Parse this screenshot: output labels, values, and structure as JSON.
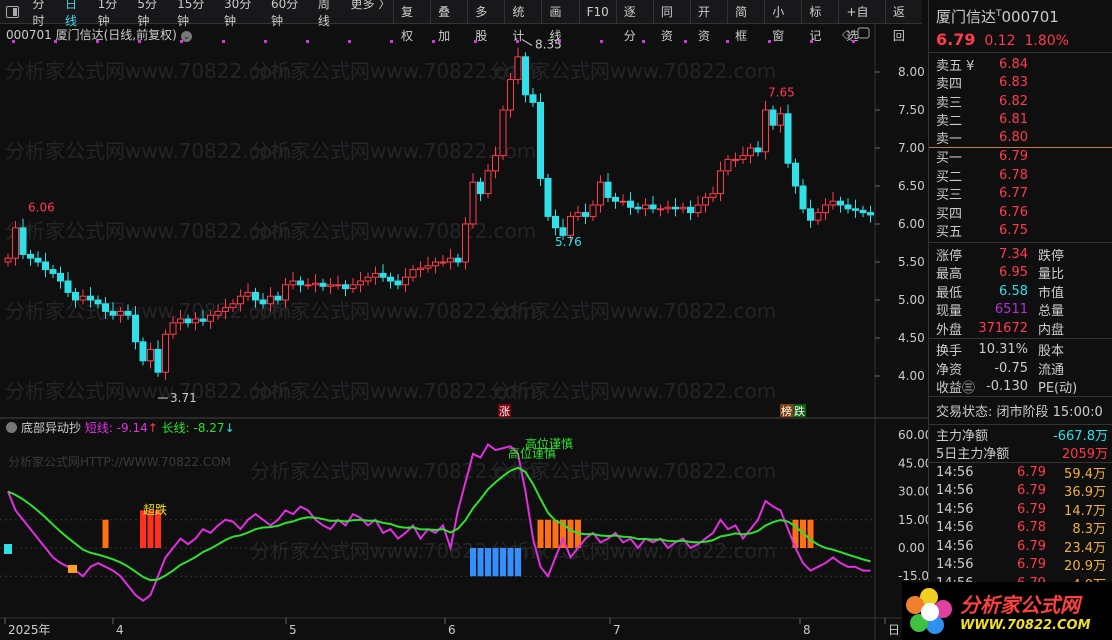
{
  "toolbar": {
    "periods": [
      "分时",
      "日线",
      "1分钟",
      "5分钟",
      "15分钟",
      "30分钟",
      "60分钟",
      "周线",
      "更多 〉"
    ],
    "active": 1,
    "buttons": [
      "复权",
      "叠加",
      "多股",
      "统计",
      "画线",
      "F10",
      "逐分",
      "同资",
      "开资",
      "简框",
      "小窗",
      "标记",
      "+自选",
      "返回"
    ]
  },
  "chart": {
    "title": "000701 厦门信达(日线,前复权)",
    "y_ticks": [
      "8.00",
      "7.50",
      "7.00",
      "6.50",
      "6.00",
      "5.50",
      "5.00",
      "4.50",
      "4.00"
    ],
    "labels": {
      "high1": "6.06",
      "peak": "8.35",
      "low1": "3.71",
      "low2": "5.76",
      "high2": "7.65"
    },
    "flags": {
      "up": "涨",
      "rank": "榜",
      "down": "跌"
    }
  },
  "chart_data": {
    "type": "candlestick",
    "ylim": [
      3.6,
      8.5
    ],
    "closes": [
      5.55,
      5.95,
      5.6,
      5.55,
      5.5,
      5.4,
      5.35,
      5.25,
      5.1,
      5.0,
      5.05,
      5.0,
      4.95,
      4.85,
      4.8,
      4.85,
      4.8,
      4.45,
      4.2,
      4.35,
      4.05,
      4.55,
      4.7,
      4.75,
      4.7,
      4.75,
      4.72,
      4.8,
      4.85,
      4.9,
      4.95,
      5.05,
      5.1,
      5.0,
      4.95,
      5.05,
      5.0,
      5.2,
      5.25,
      5.2,
      5.2,
      5.22,
      5.18,
      5.2,
      5.2,
      5.15,
      5.2,
      5.25,
      5.3,
      5.35,
      5.3,
      5.25,
      5.2,
      5.3,
      5.4,
      5.42,
      5.45,
      5.5,
      5.5,
      5.55,
      5.5,
      6.0,
      6.55,
      6.4,
      6.7,
      6.9,
      7.5,
      7.9,
      8.2,
      7.7,
      7.6,
      6.6,
      6.1,
      5.95,
      5.85,
      6.1,
      6.15,
      6.1,
      6.25,
      6.55,
      6.35,
      6.3,
      6.3,
      6.22,
      6.2,
      6.25,
      6.2,
      6.2,
      6.22,
      6.2,
      6.22,
      6.15,
      6.25,
      6.35,
      6.4,
      6.7,
      6.85,
      6.85,
      6.9,
      7.0,
      6.95,
      7.5,
      7.3,
      7.45,
      6.8,
      6.5,
      6.2,
      6.05,
      6.15,
      6.25,
      6.3,
      6.25,
      6.2,
      6.18,
      6.15,
      6.12
    ],
    "x_labels": [
      "2025年",
      "4",
      "5",
      "6",
      "7",
      "8",
      "日"
    ]
  },
  "indicator": {
    "name": "底部异动抄",
    "short_label": "短线: -9.14",
    "long_label": "长线: -8.27",
    "up_arrow": "↑",
    "down_arrow": "↓",
    "watermark": "分析家公式网HTTP://WWW.70822.COM",
    "y_ticks": [
      "60.00",
      "45.00",
      "30.00",
      "15.00",
      "0.00",
      "-15.00"
    ],
    "annotations": {
      "oversold": "超跌",
      "high_caution": "高位谨慎"
    },
    "short": [
      30,
      20,
      15,
      10,
      5,
      0,
      -5,
      -8,
      -10,
      -12,
      -15,
      -10,
      -8,
      -10,
      -12,
      -15,
      -20,
      -25,
      -28,
      -25,
      -15,
      -5,
      0,
      5,
      2,
      5,
      10,
      8,
      12,
      15,
      14,
      10,
      15,
      18,
      15,
      12,
      15,
      20,
      18,
      22,
      20,
      15,
      12,
      10,
      15,
      12,
      18,
      16,
      12,
      15,
      8,
      10,
      5,
      8,
      12,
      5,
      10,
      8,
      12,
      0,
      20,
      35,
      50,
      48,
      55,
      52,
      53,
      54,
      50,
      30,
      5,
      -10,
      -15,
      -5,
      5,
      -5,
      0,
      5,
      8,
      3,
      5,
      8,
      3,
      5,
      0,
      5,
      3,
      5,
      0,
      3,
      5,
      0,
      2,
      5,
      8,
      15,
      10,
      12,
      5,
      10,
      15,
      25,
      22,
      20,
      10,
      0,
      -8,
      -12,
      -10,
      -8,
      -5,
      -8,
      -10,
      -10,
      -12,
      -12
    ],
    "signals": {
      "orange": [
        13,
        71,
        72,
        73,
        74,
        75,
        76,
        105,
        106,
        107
      ],
      "red": [
        18,
        19,
        20
      ],
      "blue": [
        62,
        63,
        64,
        65,
        66,
        67,
        68
      ]
    }
  },
  "quote": {
    "name": "厦门信达",
    "tmark": "T",
    "code": "000701",
    "price": "6.79",
    "change": "0.12",
    "pct": "1.80%",
    "asks": [
      {
        "l": "卖五 ¥",
        "v": "6.84"
      },
      {
        "l": "卖四",
        "v": "6.83"
      },
      {
        "l": "卖三",
        "v": "6.82"
      },
      {
        "l": "卖二",
        "v": "6.81"
      },
      {
        "l": "卖一",
        "v": "6.80"
      }
    ],
    "bids": [
      {
        "l": "买一",
        "v": "6.79"
      },
      {
        "l": "买二",
        "v": "6.78"
      },
      {
        "l": "买三",
        "v": "6.77"
      },
      {
        "l": "买四",
        "v": "6.76"
      },
      {
        "l": "买五",
        "v": "6.75"
      }
    ],
    "stats": [
      {
        "l": "涨停",
        "v": "7.34",
        "c": "red",
        "l2": "跌停"
      },
      {
        "l": "最高",
        "v": "6.95",
        "c": "red",
        "l2": "量比"
      },
      {
        "l": "最低",
        "v": "6.58",
        "c": "cyan",
        "l2": "市值"
      },
      {
        "l": "现量",
        "v": "6511",
        "c": "pur",
        "l2": "总量"
      },
      {
        "l": "外盘",
        "v": "371672",
        "c": "red",
        "l2": "内盘"
      }
    ],
    "stats2": [
      {
        "l": "换手",
        "v": "10.31%",
        "l2": "股本"
      },
      {
        "l": "净资",
        "v": "-0.75",
        "l2": "流通"
      },
      {
        "l": "收益㊂",
        "v": "-0.130",
        "l2": "PE(动)"
      }
    ],
    "status": "交易状态: 闭市阶段 15:00:0",
    "flow": [
      {
        "l": "主力净额",
        "v": "-667.8万"
      },
      {
        "l": "5日主力净额",
        "v": "2059万"
      }
    ],
    "ticks": [
      {
        "t": "14:56",
        "p": "6.79",
        "v": "59.4万"
      },
      {
        "t": "14:56",
        "p": "6.79",
        "v": "36.9万"
      },
      {
        "t": "14:56",
        "p": "6.79",
        "v": "14.7万"
      },
      {
        "t": "14:56",
        "p": "6.78",
        "v": "8.3万"
      },
      {
        "t": "14:56",
        "p": "6.79",
        "v": "23.4万"
      },
      {
        "t": "14:56",
        "p": "6.79",
        "v": "20.9万"
      },
      {
        "t": "14:56",
        "p": "6.79",
        "v": "4.0万"
      }
    ]
  },
  "logo": {
    "title": "分析家公式网",
    "url": "WWW.70822.COM"
  },
  "watermark": "分析家公式网www.70822.com"
}
